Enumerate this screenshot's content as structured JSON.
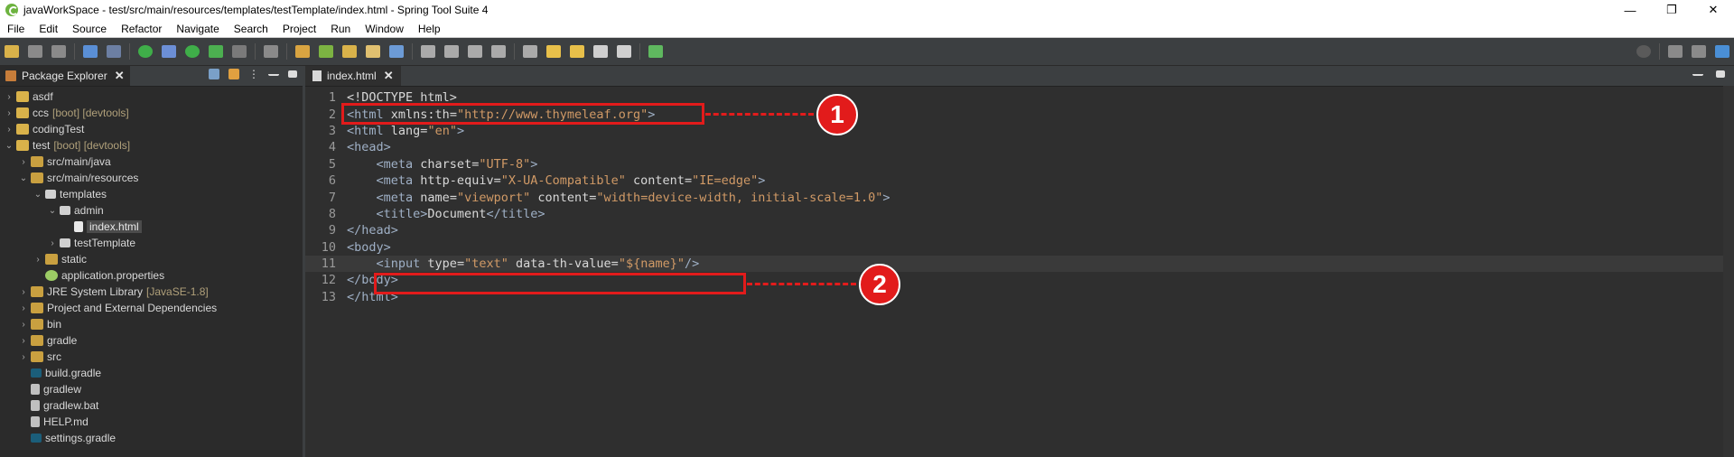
{
  "window": {
    "title": "javaWorkSpace - test/src/main/resources/templates/testTemplate/index.html - Spring Tool Suite 4",
    "controls": [
      "—",
      "❐",
      "✕"
    ]
  },
  "menu": [
    "File",
    "Edit",
    "Source",
    "Refactor",
    "Navigate",
    "Search",
    "Project",
    "Run",
    "Window",
    "Help"
  ],
  "explorer": {
    "tab_label": "Package Explorer",
    "close": "✕",
    "items": [
      {
        "label": "asdf",
        "deco": "",
        "arrow": "›",
        "indent": 0,
        "icon": "proj"
      },
      {
        "label": "ccs",
        "deco": "[boot] [devtools]",
        "arrow": "›",
        "indent": 0,
        "icon": "proj"
      },
      {
        "label": "codingTest",
        "deco": "",
        "arrow": "›",
        "indent": 0,
        "icon": "proj"
      },
      {
        "label": "test",
        "deco": "[boot] [devtools]",
        "arrow": "⌄",
        "indent": 0,
        "icon": "proj"
      },
      {
        "label": "src/main/java",
        "deco": "",
        "arrow": "›",
        "indent": 1,
        "icon": "pkgfolder"
      },
      {
        "label": "src/main/resources",
        "deco": "",
        "arrow": "⌄",
        "indent": 1,
        "icon": "pkgfolder"
      },
      {
        "label": "templates",
        "deco": "",
        "arrow": "⌄",
        "indent": 2,
        "icon": "pkg"
      },
      {
        "label": "admin",
        "deco": "",
        "arrow": "⌄",
        "indent": 3,
        "icon": "pkg"
      },
      {
        "label": "index.html",
        "deco": "",
        "arrow": "",
        "indent": 4,
        "icon": "html",
        "selected": true
      },
      {
        "label": "testTemplate",
        "deco": "",
        "arrow": "›",
        "indent": 3,
        "icon": "pkg"
      },
      {
        "label": "static",
        "deco": "",
        "arrow": "›",
        "indent": 2,
        "icon": "pkgfolder"
      },
      {
        "label": "application.properties",
        "deco": "",
        "arrow": "",
        "indent": 2,
        "icon": "props"
      },
      {
        "label": "JRE System Library",
        "deco": "[JavaSE-1.8]",
        "arrow": "›",
        "indent": 1,
        "icon": "lib"
      },
      {
        "label": "Project and External Dependencies",
        "deco": "",
        "arrow": "›",
        "indent": 1,
        "icon": "lib"
      },
      {
        "label": "bin",
        "deco": "",
        "arrow": "›",
        "indent": 1,
        "icon": "pkgfolder"
      },
      {
        "label": "gradle",
        "deco": "",
        "arrow": "›",
        "indent": 1,
        "icon": "pkgfolder"
      },
      {
        "label": "src",
        "deco": "",
        "arrow": "›",
        "indent": 1,
        "icon": "pkgfolder"
      },
      {
        "label": "build.gradle",
        "deco": "",
        "arrow": "",
        "indent": 1,
        "icon": "gradle"
      },
      {
        "label": "gradlew",
        "deco": "",
        "arrow": "",
        "indent": 1,
        "icon": "file"
      },
      {
        "label": "gradlew.bat",
        "deco": "",
        "arrow": "",
        "indent": 1,
        "icon": "file"
      },
      {
        "label": "HELP.md",
        "deco": "",
        "arrow": "",
        "indent": 1,
        "icon": "file"
      },
      {
        "label": "settings.gradle",
        "deco": "",
        "arrow": "",
        "indent": 1,
        "icon": "gradle"
      }
    ]
  },
  "editor": {
    "tab_label": "index.html",
    "close": "✕",
    "lines": [
      {
        "n": "1",
        "parts": [
          [
            "txt",
            "<!DOCTYPE html>"
          ]
        ]
      },
      {
        "n": "2",
        "parts": [
          [
            "tag",
            "<html "
          ],
          [
            "attr",
            "xmlns:th"
          ],
          [
            "txt",
            "="
          ],
          [
            "val",
            "\"http://www.thymeleaf.org\""
          ],
          [
            "tag",
            ">"
          ]
        ]
      },
      {
        "n": "3",
        "fold": true,
        "parts": [
          [
            "tag",
            "<html "
          ],
          [
            "attr",
            "lang"
          ],
          [
            "txt",
            "="
          ],
          [
            "val",
            "\"en\""
          ],
          [
            "tag",
            ">"
          ]
        ]
      },
      {
        "n": "4",
        "fold": true,
        "parts": [
          [
            "tag",
            "<head>"
          ]
        ]
      },
      {
        "n": "5",
        "parts": [
          [
            "txt",
            "    "
          ],
          [
            "tag",
            "<meta "
          ],
          [
            "attr",
            "charset"
          ],
          [
            "txt",
            "="
          ],
          [
            "val",
            "\"UTF-8\""
          ],
          [
            "tag",
            ">"
          ]
        ]
      },
      {
        "n": "6",
        "parts": [
          [
            "txt",
            "    "
          ],
          [
            "tag",
            "<meta "
          ],
          [
            "attr",
            "http-equiv"
          ],
          [
            "txt",
            "="
          ],
          [
            "val",
            "\"X-UA-Compatible\""
          ],
          [
            "txt",
            " "
          ],
          [
            "attr",
            "content"
          ],
          [
            "txt",
            "="
          ],
          [
            "val",
            "\"IE=edge\""
          ],
          [
            "tag",
            ">"
          ]
        ]
      },
      {
        "n": "7",
        "parts": [
          [
            "txt",
            "    "
          ],
          [
            "tag",
            "<meta "
          ],
          [
            "attr",
            "name"
          ],
          [
            "txt",
            "="
          ],
          [
            "val",
            "\"viewport\""
          ],
          [
            "txt",
            " "
          ],
          [
            "attr",
            "content"
          ],
          [
            "txt",
            "="
          ],
          [
            "val",
            "\"width=device-width, initial-scale=1.0\""
          ],
          [
            "tag",
            ">"
          ]
        ]
      },
      {
        "n": "8",
        "parts": [
          [
            "txt",
            "    "
          ],
          [
            "tag",
            "<title>"
          ],
          [
            "txt",
            "Document"
          ],
          [
            "tag",
            "</title>"
          ]
        ]
      },
      {
        "n": "9",
        "parts": [
          [
            "tag",
            "</head>"
          ]
        ]
      },
      {
        "n": "10",
        "fold": true,
        "parts": [
          [
            "tag",
            "<body>"
          ]
        ]
      },
      {
        "n": "11",
        "current": true,
        "parts": [
          [
            "txt",
            "    "
          ],
          [
            "tag",
            "<input "
          ],
          [
            "attr",
            "type"
          ],
          [
            "txt",
            "="
          ],
          [
            "val",
            "\"text\""
          ],
          [
            "txt",
            " "
          ],
          [
            "attr",
            "data-th-value"
          ],
          [
            "txt",
            "="
          ],
          [
            "val",
            "\"${name}\""
          ],
          [
            "tag",
            "/>"
          ]
        ]
      },
      {
        "n": "12",
        "parts": [
          [
            "tag",
            "</body>"
          ]
        ]
      },
      {
        "n": "13",
        "parts": [
          [
            "tag",
            "</html>"
          ]
        ]
      }
    ]
  },
  "annotations": {
    "badge1": "1",
    "badge2": "2",
    "color": "#e21b1b"
  }
}
